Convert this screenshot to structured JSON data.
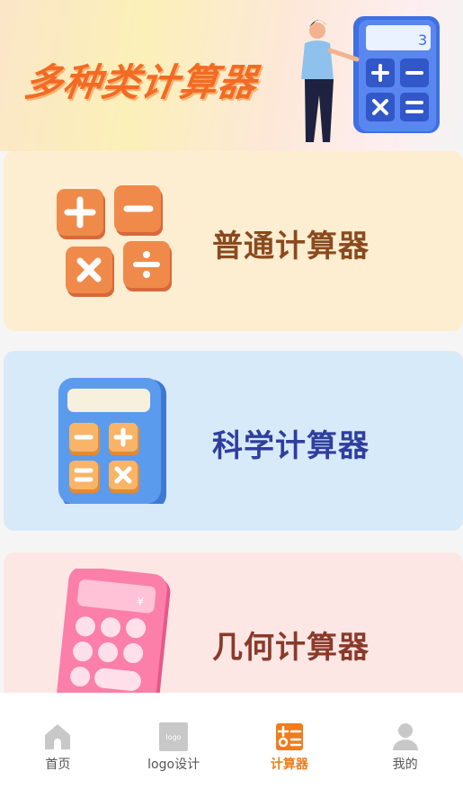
{
  "banner": {
    "title": "多种类计算器",
    "display_digit": "3"
  },
  "cards": [
    {
      "label": "普通计算器",
      "icon": "basic-calculator-icon"
    },
    {
      "label": "科学计算器",
      "icon": "scientific-calculator-icon"
    },
    {
      "label": "几何计算器",
      "icon": "geometry-calculator-icon"
    }
  ],
  "tabbar": {
    "tabs": [
      {
        "label": "首页",
        "icon": "home-icon",
        "active": false
      },
      {
        "label": "logo设计",
        "icon": "logo-icon",
        "icon_text": "logo",
        "active": false
      },
      {
        "label": "计算器",
        "icon": "calculator-icon",
        "active": true
      },
      {
        "label": "我的",
        "icon": "user-icon",
        "active": false
      }
    ]
  },
  "colors": {
    "accent": "#f07c1b",
    "card_basic_bg": "#fdeed2",
    "card_scientific_bg": "#d7eaf9",
    "card_geometry_bg": "#fde7e5"
  }
}
